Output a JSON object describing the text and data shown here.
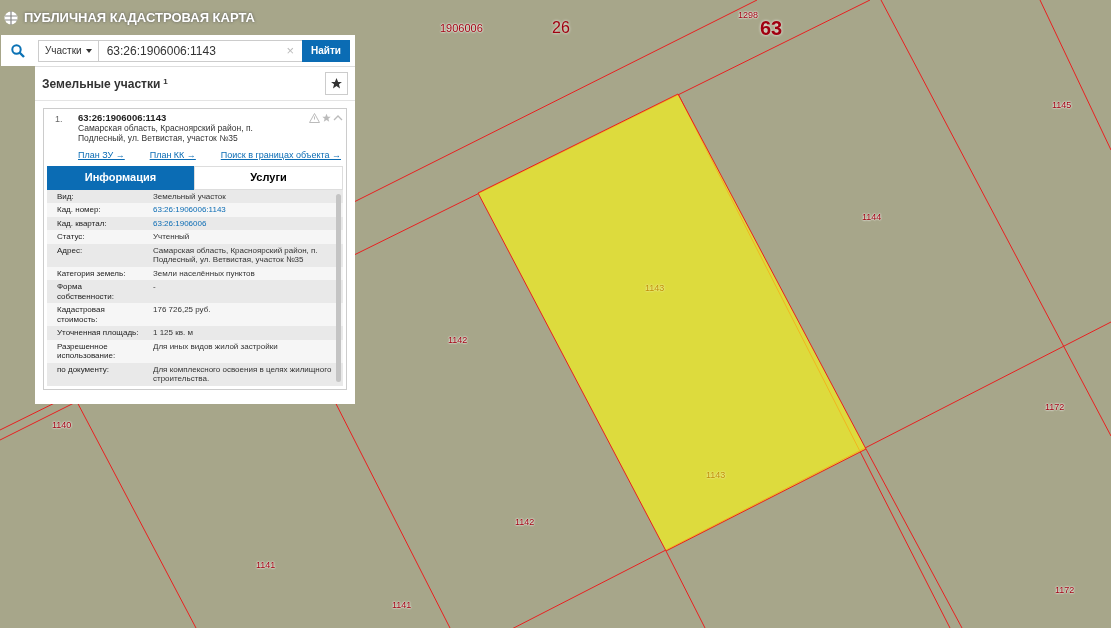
{
  "header": {
    "title": "ПУБЛИЧНАЯ КАДАСТРОВАЯ КАРТА"
  },
  "search": {
    "type": "Участки",
    "value": "63:26:1906006:1143",
    "clear": "×",
    "button": "Найти"
  },
  "results": {
    "title": "Земельные участки",
    "count": "1",
    "items": [
      {
        "index": "1.",
        "number": "63:26:1906006:1143",
        "address": "Самарская область, Красноярский район, п. Подлесный, ул. Ветвистая, участок №35",
        "expanded": true,
        "links": [
          "План ЗУ →",
          "План КК →",
          "Поиск в границах объекта →"
        ],
        "tabs": [
          {
            "label": "Информация",
            "selected": true
          },
          {
            "label": "Услуги",
            "selected": false
          }
        ],
        "rows": [
          {
            "label": "Вид:",
            "value": "Земельный участок",
            "kind": "text"
          },
          {
            "label": "Кад. номер:",
            "value": "63:26:1906006:1143",
            "kind": "link"
          },
          {
            "label": "Кад. квартал:",
            "value": "63:26:1906006",
            "kind": "link"
          },
          {
            "label": "Статус:",
            "value": "Учтенный",
            "kind": "text"
          },
          {
            "label": "Адрес:",
            "value": "Самарская область, Красноярский район, п. Подлесный, ул. Ветвистая, участок №35",
            "kind": "text"
          },
          {
            "label": "Категория земель:",
            "value": "Земли населённых пунктов",
            "kind": "text"
          },
          {
            "label": "Форма собственности:",
            "value": "-",
            "kind": "text"
          },
          {
            "label": "Кадастровая стоимость:",
            "value": "176 726,25 руб.",
            "kind": "text"
          },
          {
            "label": "Уточненная площадь:",
            "value": "1 125 кв. м",
            "kind": "text"
          },
          {
            "label": "Разрешенное использование:",
            "value": "Для иных видов жилой застройки",
            "kind": "text"
          },
          {
            "label": "по документу:",
            "value": "Для комплексного освоения в целях жилищного строительства.",
            "kind": "text"
          }
        ]
      }
    ]
  },
  "map": {
    "labels": [
      {
        "text": "1906006",
        "kind": "quarter"
      },
      {
        "text": "26",
        "kind": "district"
      },
      {
        "text": "1298",
        "kind": "parcel"
      },
      {
        "text": "63",
        "kind": "region"
      },
      {
        "text": "1145",
        "kind": "parcel"
      },
      {
        "text": "1144",
        "kind": "parcel"
      },
      {
        "text": "1143",
        "kind": "selected"
      },
      {
        "text": "1142",
        "kind": "parcel"
      },
      {
        "text": "1143",
        "kind": "selected"
      },
      {
        "text": "1172",
        "kind": "parcel"
      },
      {
        "text": "1140",
        "kind": "parcel"
      },
      {
        "text": "1142",
        "kind": "parcel"
      },
      {
        "text": "1141",
        "kind": "parcel"
      },
      {
        "text": "1141",
        "kind": "parcel"
      },
      {
        "text": "1172",
        "kind": "parcel"
      }
    ]
  }
}
